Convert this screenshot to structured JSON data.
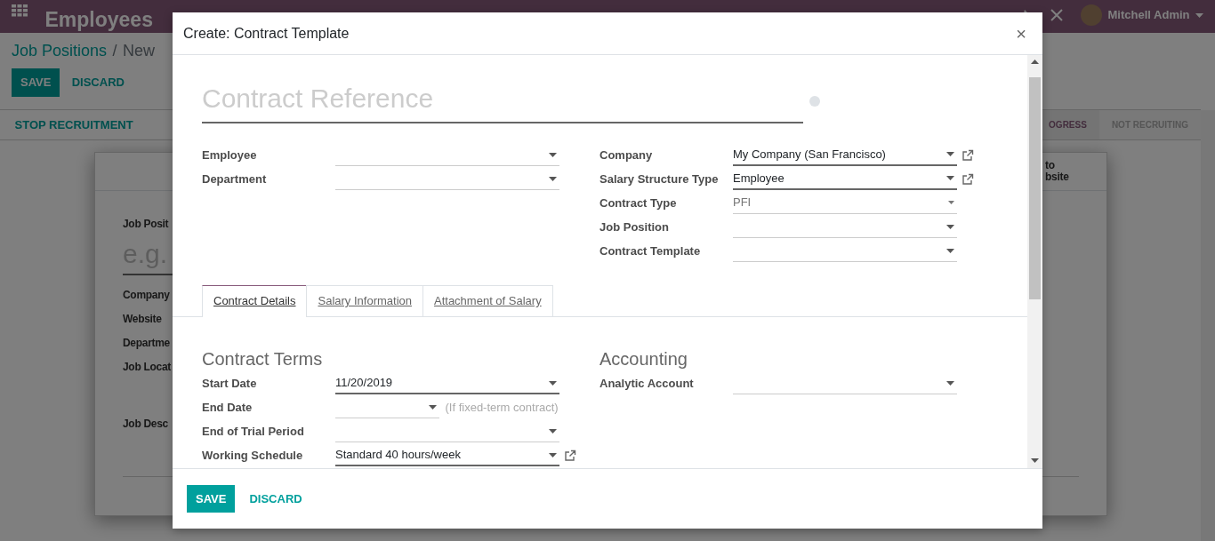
{
  "app": {
    "title": "Employees",
    "user": "Mitchell Admin"
  },
  "background_form": {
    "breadcrumb": [
      "Job Positions",
      "New"
    ],
    "breadcrumb_separator": "/",
    "buttons": [
      "SAVE",
      "DISCARD"
    ],
    "header_button": "STOP RECRUITMENT",
    "stages": [
      {
        "label": "OGRESS",
        "selected": true
      },
      {
        "label": "NOT RECRUITING",
        "selected": false
      }
    ],
    "website_button": [
      "to",
      "bsite"
    ],
    "title_label": "Job Posit",
    "title_placeholder": "e.g.",
    "fields": [
      "Company",
      "Website",
      "Departme",
      "Job Locat"
    ],
    "description_label": "Job Desc"
  },
  "dialog": {
    "title": "Create: Contract Template",
    "close": "×",
    "name_placeholder": "Contract Reference",
    "left_fields": [
      {
        "label": "Employee",
        "required": false,
        "external_link": false
      },
      {
        "label": "Department",
        "required": false,
        "external_link": false
      }
    ],
    "right_fields": [
      {
        "label": "Company",
        "value": "My Company (San Francisco)",
        "required": true,
        "external_link": true
      },
      {
        "label": "Salary Structure Type",
        "value": "Employee",
        "required": true,
        "external_link": true
      },
      {
        "label": "Contract Type",
        "value": "PFI",
        "kind": "selection",
        "required": false,
        "external_link": false
      },
      {
        "label": "Job Position",
        "required": false,
        "external_link": false
      },
      {
        "label": "Contract Template",
        "required": false,
        "external_link": false
      }
    ],
    "tabs": [
      {
        "label": "Contract Details",
        "selected": true
      },
      {
        "label": "Salary Information",
        "selected": false
      },
      {
        "label": "Attachment of Salary",
        "selected": false
      }
    ],
    "sections": [
      {
        "title": "Contract Terms",
        "fields": [
          {
            "label": "Start Date",
            "value": "11/20/2019",
            "required": true,
            "external_link": false
          },
          {
            "label": "End Date",
            "kind": "date",
            "note": "(If fixed-term contract)",
            "required": false,
            "external_link": false
          },
          {
            "label": "End of Trial Period",
            "required": false,
            "external_link": false
          },
          {
            "label": "Working Schedule",
            "value": "Standard 40 hours/week",
            "required": true,
            "external_link": true
          }
        ]
      },
      {
        "title": "Accounting",
        "fields": [
          {
            "label": "Analytic Account",
            "required": false,
            "external_link": false
          }
        ]
      }
    ],
    "buttons": [
      "SAVE",
      "DISCARD"
    ]
  }
}
